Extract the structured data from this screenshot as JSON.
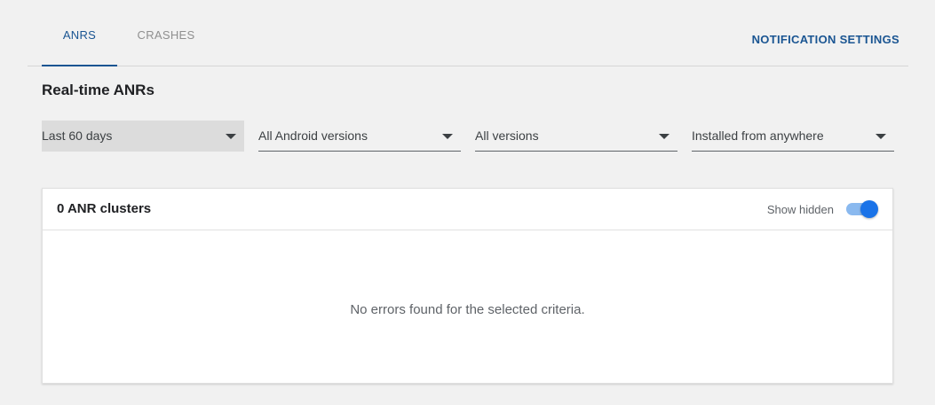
{
  "tabs": [
    {
      "label": "ANRS",
      "active": true
    },
    {
      "label": "CRASHES",
      "active": false
    }
  ],
  "notification_settings_label": "NOTIFICATION SETTINGS",
  "section_title": "Real-time ANRs",
  "filters": {
    "period": {
      "value": "Last 60 days",
      "icon": "arrow-drop-down-icon"
    },
    "android_version": {
      "value": "All Android versions",
      "icon": "arrow-drop-down-icon"
    },
    "app_version": {
      "value": "All versions",
      "icon": "arrow-drop-down-icon"
    },
    "install_source": {
      "value": "Installed from anywhere",
      "icon": "arrow-drop-down-icon"
    }
  },
  "card": {
    "title": "0 ANR clusters",
    "show_hidden_label": "Show hidden",
    "show_hidden_enabled": true,
    "empty_message": "No errors found for the selected criteria."
  },
  "colors": {
    "accent": "#1a5592",
    "toggle_thumb": "#1a73e8",
    "toggle_track": "#8ab9ef",
    "background": "#f1f1f1"
  }
}
